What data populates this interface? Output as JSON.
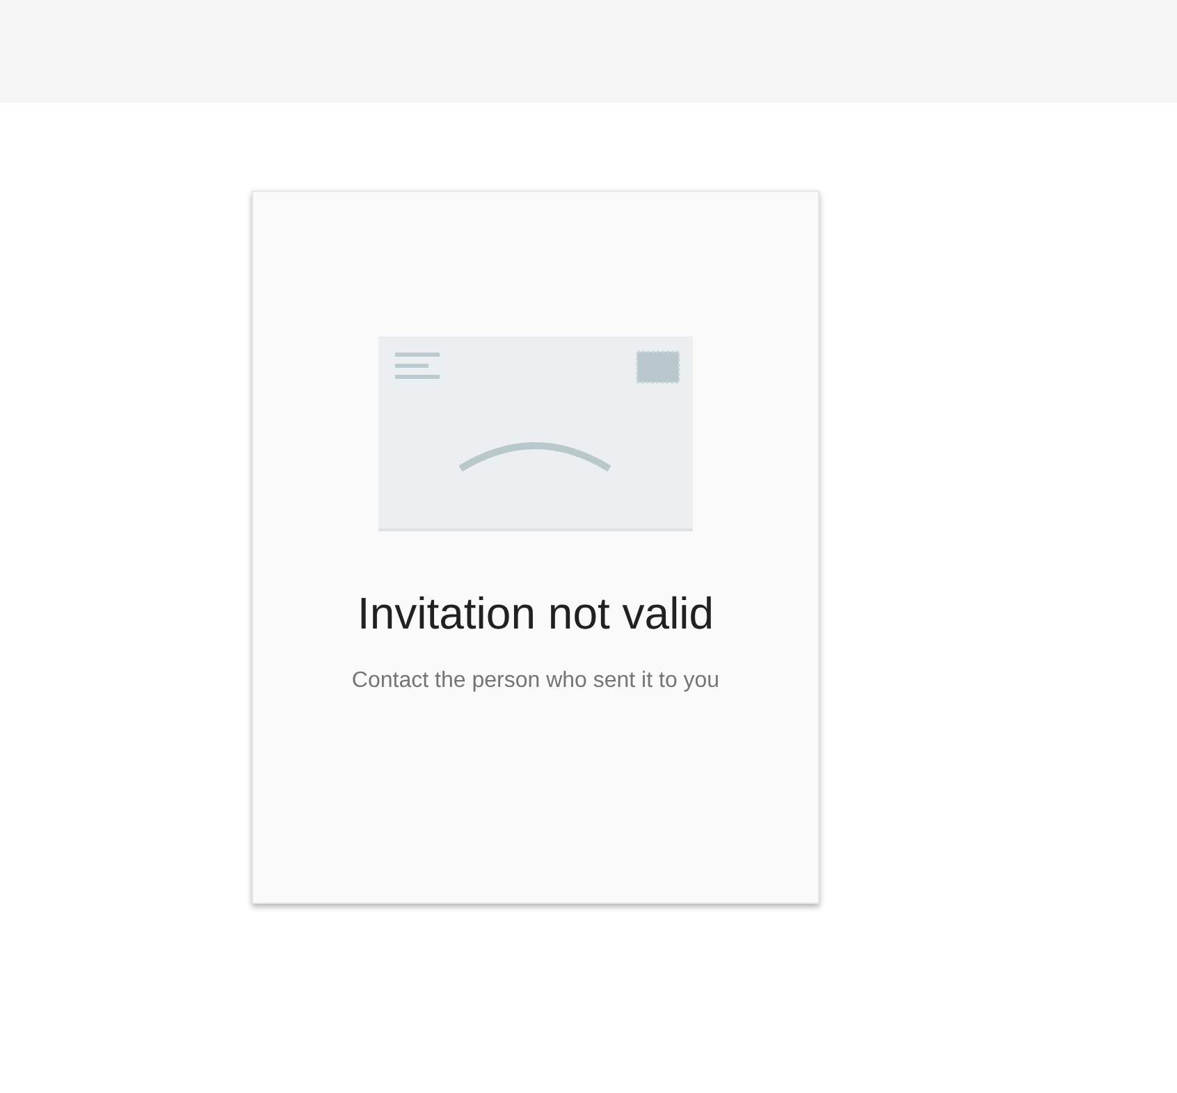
{
  "card": {
    "title": "Invitation not valid",
    "message": "Contact the person who sent it to you"
  }
}
